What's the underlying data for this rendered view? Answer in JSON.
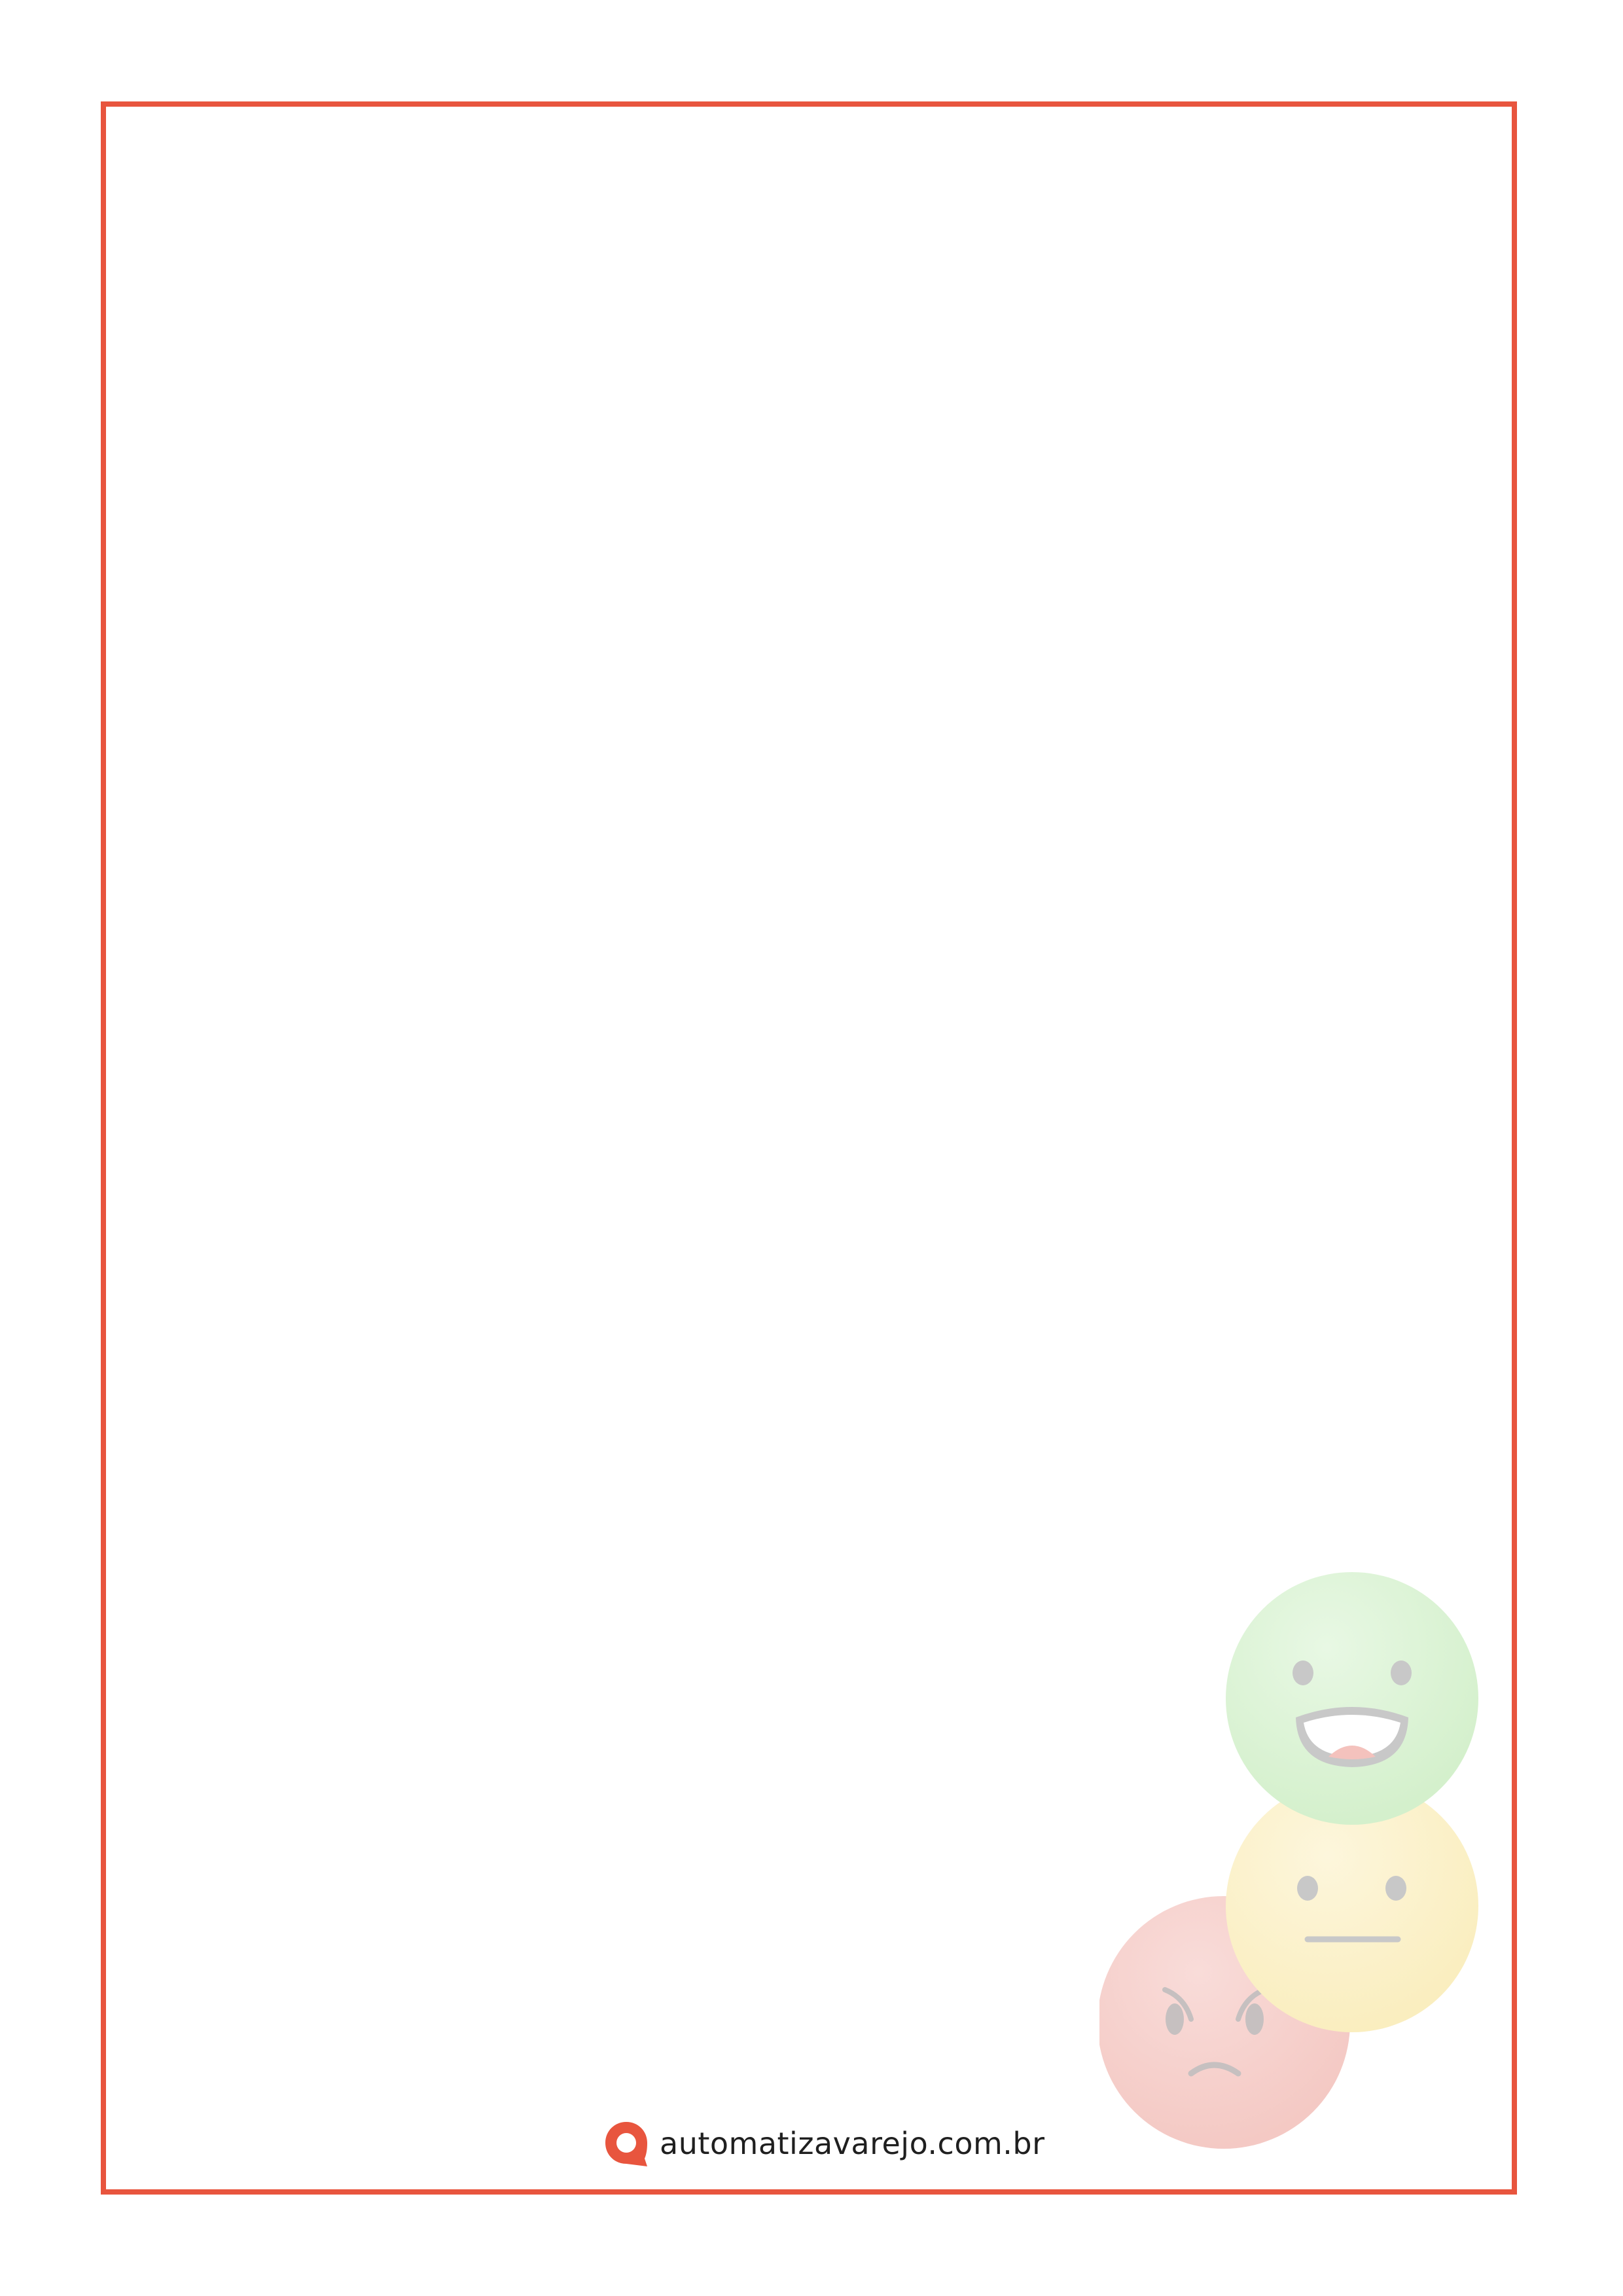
{
  "brand": {
    "url": "automatizavarejo.com.br",
    "accent_color": "#e8553e"
  },
  "decorations": {
    "icons": [
      "happy-face-icon",
      "neutral-face-icon",
      "angry-face-icon"
    ],
    "colors": {
      "happy": "#d9f2d4",
      "neutral": "#fbf1c8",
      "angry": "#f6cfcb",
      "features": "#c8c8c8"
    }
  }
}
